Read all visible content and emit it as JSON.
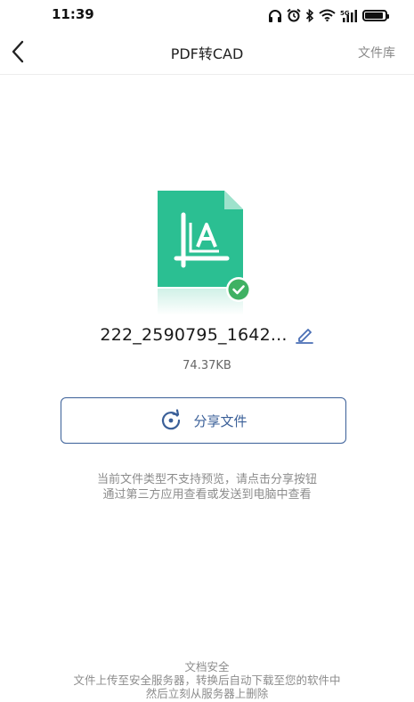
{
  "status_bar": {
    "time": "11:39",
    "network_label": "5G",
    "battery_level": 0.9,
    "icons": [
      "headphones-icon",
      "alarm-icon",
      "bluetooth-icon",
      "wifi-icon",
      "cellular-signal-icon",
      "battery-icon"
    ]
  },
  "nav": {
    "title": "PDF转CAD",
    "right_label": "文件库",
    "back_icon": "chevron-left-icon"
  },
  "file": {
    "name": "222_2590795_1642...",
    "size": "74.37KB",
    "icon": "cad-file-icon",
    "status_icon": "check-circle-icon",
    "edit_icon": "pencil-icon"
  },
  "share": {
    "label": "分享文件",
    "icon": "share-refresh-icon"
  },
  "hint": {
    "line1": "当前文件类型不支持预览，请点击分享按钮",
    "line2": "通过第三方应用查看或发送到电脑中查看"
  },
  "footer": {
    "title": "文档安全",
    "line1": "文件上传至安全服务器，转换后自动下载至您的软件中",
    "line2": "然后立刻从服务器上删除"
  },
  "colors": {
    "accent_green": "#2bbf92",
    "check_green": "#3fb163",
    "button_blue": "#3a5f98",
    "edit_blue": "#4a6fb5"
  }
}
